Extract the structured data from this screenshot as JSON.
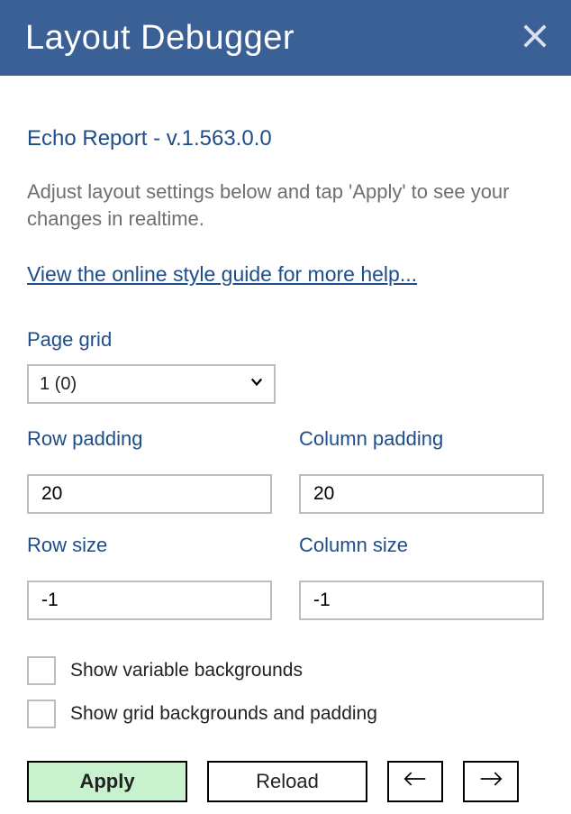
{
  "titlebar": {
    "title": "Layout Debugger"
  },
  "subtitle": "Echo Report - v.1.563.0.0",
  "description": "Adjust layout settings below and tap 'Apply' to see your changes in realtime.",
  "help_link": "View the online style guide for more help...",
  "page_grid": {
    "label": "Page grid",
    "selected": "1 (0)"
  },
  "row_padding": {
    "label": "Row padding",
    "value": "20"
  },
  "column_padding": {
    "label": "Column padding",
    "value": "20"
  },
  "row_size": {
    "label": "Row size",
    "value": "-1"
  },
  "column_size": {
    "label": "Column size",
    "value": "-1"
  },
  "checkboxes": {
    "variable_bg": {
      "label": "Show variable backgrounds",
      "checked": false
    },
    "grid_bg": {
      "label": "Show grid backgrounds and padding",
      "checked": false
    }
  },
  "buttons": {
    "apply": "Apply",
    "reload": "Reload"
  }
}
